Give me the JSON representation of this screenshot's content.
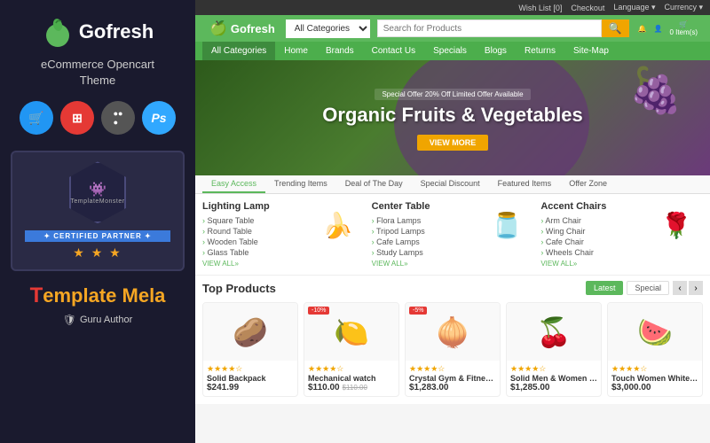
{
  "left": {
    "logo": {
      "text": "Gofresh",
      "icon": "🍏"
    },
    "tagline": "eCommerce Opencart\nTheme",
    "tech_icons": [
      {
        "label": "🛒",
        "type": "cart",
        "bg": "cart"
      },
      {
        "label": "⊞",
        "type": "responsive",
        "bg": "responsive"
      },
      {
        "label": "●●●",
        "type": "joomla",
        "bg": "joomla"
      },
      {
        "label": "Ps",
        "type": "ps",
        "bg": "ps"
      }
    ],
    "partner": {
      "monster_label": "TemplateMonster",
      "certified_text": "✦ CERTIFIED PARTNER ✦",
      "stars": "★ ★ ★"
    },
    "brand": {
      "t_letter": "T",
      "mela_text": "emplate Mela"
    },
    "guru": {
      "icon": "🛡",
      "label": "Guru Author"
    }
  },
  "topbar": {
    "items": [
      "Wish List [0]",
      "Checkout",
      "Language ▾",
      "Currency ▾"
    ]
  },
  "nav": {
    "brand": "Gofresh",
    "category_placeholder": "All Categories",
    "search_placeholder": "Search for Products",
    "search_btn_icon": "🔍",
    "icons": [
      {
        "icon": "🔔",
        "label": ""
      },
      {
        "icon": "👤",
        "label": ""
      },
      {
        "icon": "🛒",
        "label": "0 Item(s)"
      }
    ]
  },
  "subnav": {
    "items": [
      "All Categories",
      "Home",
      "Brands",
      "Contact Us",
      "Specials",
      "Blogs",
      "Returns",
      "Site-Map"
    ]
  },
  "hero": {
    "badge": "Special Offer 20% Off  Limited Offer Available",
    "title": "Organic Fruits & Vegetables",
    "btn_label": "VIEW MORE",
    "bg_emoji": "🍇"
  },
  "tabs": {
    "items": [
      "Easy Access",
      "Trending Items",
      "Deal of The Day",
      "Special Discount",
      "Featured Items",
      "Offer Zone"
    ]
  },
  "sections": [
    {
      "title": "Lighting Lamp",
      "items": [
        "Square Table",
        "Round Table",
        "Wooden Table",
        "Glass Table"
      ],
      "view_all": "VIEW ALL»",
      "emoji": "🍌"
    },
    {
      "title": "Center Table",
      "items": [
        "Flora Lamps",
        "Tripod Lamps",
        "Cafe Lamps",
        "Study Lamps"
      ],
      "view_all": "VIEW ALL»",
      "emoji": "🫙"
    },
    {
      "title": "Accent Chairs",
      "items": [
        "Arm Chair",
        "Wing Chair",
        "Cafe Chair",
        "Wheels Chair"
      ],
      "view_all": "VIEW ALL»",
      "emoji": "🌹"
    }
  ],
  "top_products": {
    "title": "Top Products",
    "tabs": [
      "Latest",
      "Special"
    ],
    "nav_arrows": [
      "‹",
      "›"
    ],
    "products": [
      {
        "name": "Solid Backpack",
        "price": "$241.99",
        "old_price": "",
        "stars": "★★★★☆",
        "emoji": "🥔",
        "badge": ""
      },
      {
        "name": "Mechanical watch",
        "price": "$110.00",
        "old_price": "$110.00",
        "stars": "★★★★☆",
        "emoji": "🍋",
        "badge": "-10%"
      },
      {
        "name": "Crystal Gym & Fitness Glove",
        "price": "$1,283.00",
        "old_price": "",
        "stars": "★★★★☆",
        "emoji": "🧅",
        "badge": "-5%"
      },
      {
        "name": "Solid Men & Women Muffler",
        "price": "$1,285.00",
        "old_price": "",
        "stars": "★★★★☆",
        "emoji": "🍒",
        "badge": ""
      },
      {
        "name": "Touch Women White Heels",
        "price": "$3,000.00",
        "old_price": "",
        "stars": "★★★★☆",
        "emoji": "🍉",
        "badge": ""
      }
    ]
  }
}
